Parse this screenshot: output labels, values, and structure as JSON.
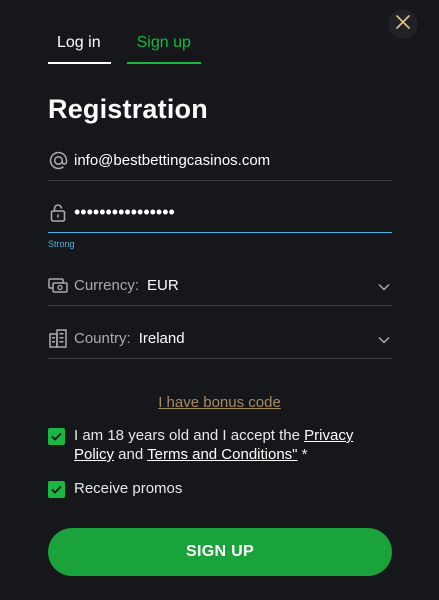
{
  "tabs": {
    "login": "Log in",
    "signup": "Sign up"
  },
  "title": "Registration",
  "email": {
    "value": "info@bestbettingcasinos.com"
  },
  "password": {
    "value": "••••••••••••••••",
    "strength": "Strong"
  },
  "currency": {
    "label": "Currency:",
    "value": "EUR"
  },
  "country": {
    "label": "Country:",
    "value": "Ireland"
  },
  "bonus_link": "I have bonus code",
  "terms": {
    "prefix": "I am 18 years old and I accept the ",
    "privacy_link": "Privacy Policy",
    "and": " and ",
    "terms_link": "Terms and Conditions\"",
    "suffix": " *",
    "checked": true
  },
  "promos": {
    "label": "Receive promos",
    "checked": true
  },
  "signup_button": "SIGN UP",
  "colors": {
    "accent_green": "#19b843",
    "focus_blue": "#46b6e0",
    "bonus_gold": "#a48b62",
    "background": "#15171b"
  },
  "icons": [
    "close-icon",
    "at-icon",
    "lock-icon",
    "currency-icon",
    "building-icon",
    "chevron-down-icon",
    "check-icon"
  ]
}
